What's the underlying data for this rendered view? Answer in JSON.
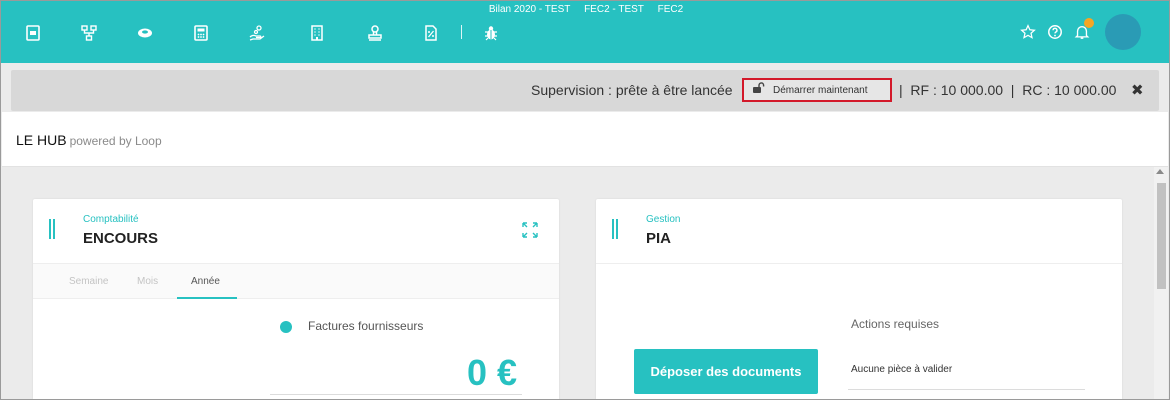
{
  "topbar": {
    "title": "Bilan 2020 - TEST     FEC2 - TEST     FEC2",
    "icons": [
      "document-icon",
      "org-chart-icon",
      "coins-icon",
      "calculator-icon",
      "hand-money-icon",
      "building-icon",
      "stamp-icon",
      "percent-doc-icon",
      "bug-icon"
    ],
    "right_icons": [
      "star-icon",
      "help-icon",
      "bell-icon"
    ]
  },
  "supervision": {
    "status": "Supervision : prête à être lancée",
    "start_button": "Démarrer maintenant",
    "figures": "|  RF : 10 000.00  |  RC : 10 000.00",
    "close": "✖"
  },
  "header": {
    "title": "LE HUB",
    "powered": "powered by Loop"
  },
  "cards": [
    {
      "subtitle": "Comptabilité",
      "title": "ENCOURS",
      "tabs": [
        "Semaine",
        "Mois",
        "Année"
      ],
      "active_tab": "Année",
      "legend": "Factures fournisseurs",
      "amount": "0 €"
    },
    {
      "subtitle": "Gestion",
      "title": "PIA",
      "actions_title": "Actions requises",
      "button": "Déposer des documents",
      "action_item": "Aucune pièce à valider"
    }
  ],
  "colors": {
    "accent": "#27c1c1",
    "highlight_border": "#d3192a",
    "notification": "#f5a623",
    "avatar": "#2a9bb5"
  }
}
